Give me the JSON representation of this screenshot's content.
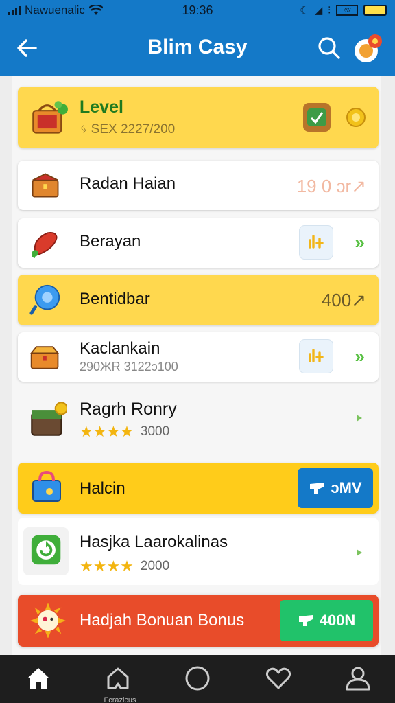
{
  "status_bar": {
    "carrier": "Nawuenalic",
    "time": "19:36",
    "battery_label": "////"
  },
  "app_bar": {
    "title": "Blim Casy"
  },
  "level_card": {
    "title": "Level",
    "progress_text": "ᛃ SEX 2227/200"
  },
  "rows": [
    {
      "title": "Radan Haian",
      "value": "19 0 ᴐr↗"
    },
    {
      "title": "Berayan"
    },
    {
      "title": "Bentidbar",
      "value": "400↗"
    },
    {
      "title": "Kaclankain",
      "subtitle": "290ЖR 3122ᴐ100"
    },
    {
      "title": "Ragrh Ronry",
      "stars": "★★★★",
      "count": "3000"
    },
    {
      "title": "Halcin",
      "button": "ᴐMV"
    },
    {
      "title": "Hasjka Laarokalinas",
      "stars": "★★★★",
      "count": "2000"
    },
    {
      "title": "Hadjah Bonuan Bonus",
      "button": "400N"
    }
  ],
  "bottom_nav": {
    "items": [
      "home",
      "favorites",
      "circle",
      "heart",
      "profile"
    ],
    "active_label": "Fcrazicus"
  },
  "colors": {
    "app_bar": "#1479c8",
    "yellow_card": "#ffd84e",
    "orange_card": "#e84c2a",
    "green_button": "#21c26a",
    "blue_button": "#1479c8"
  }
}
